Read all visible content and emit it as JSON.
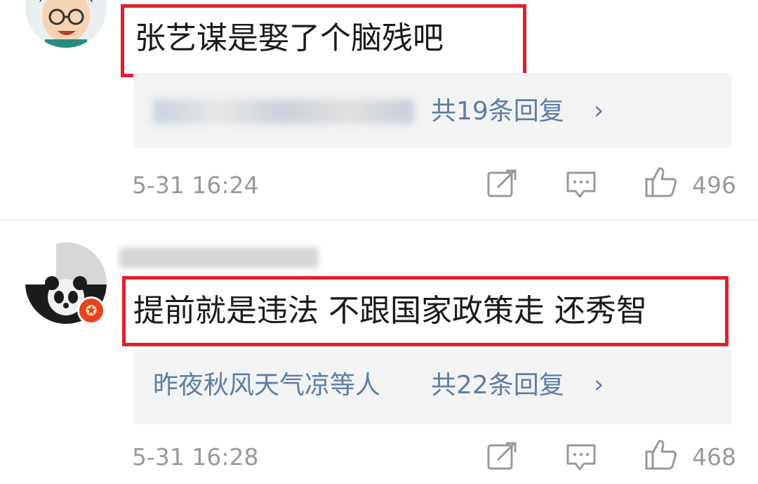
{
  "comments": [
    {
      "text": "张艺谋是娶了个脑残吧",
      "replies_count_label": "共19条回复",
      "arrow": "›",
      "time": "5-31 16:24",
      "likes": "496"
    },
    {
      "text": "提前就是违法 不跟国家政策走 还秀智",
      "replies_preview": "昨夜秋风天气凉等人",
      "replies_count_label": "共22条回复",
      "arrow": "›",
      "time": "5-31 16:28",
      "likes": "468",
      "badge": "✪"
    }
  ],
  "colors": {
    "highlight": "#e0202c",
    "link": "#5b7ea6",
    "meta": "#999999"
  },
  "icons": [
    "share-icon",
    "comment-icon",
    "thumbs-up-icon"
  ]
}
